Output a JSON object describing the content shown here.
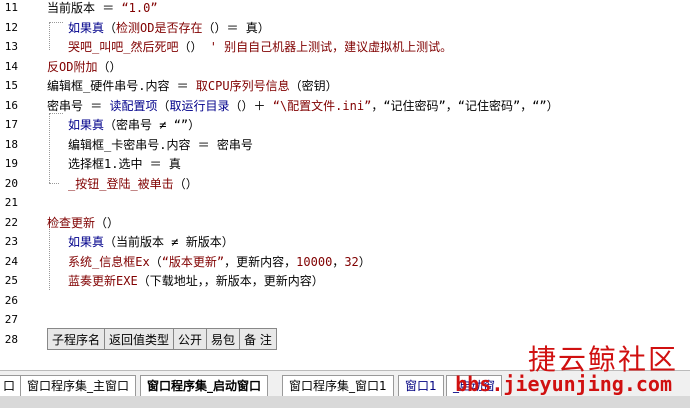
{
  "lines": [
    {
      "num": "11",
      "indent": 47,
      "parts": [
        {
          "c": "blk",
          "t": "当前版本 ＝ "
        },
        {
          "c": "fn",
          "t": "“1.0”"
        }
      ]
    },
    {
      "num": "12",
      "indent": 68,
      "parts": [
        {
          "c": "kw",
          "t": "如果真"
        },
        {
          "c": "blk",
          "t": "（"
        },
        {
          "c": "fn",
          "t": "检测OD是否存在"
        },
        {
          "c": "blk",
          "t": "（）＝ 真）"
        }
      ]
    },
    {
      "num": "13",
      "indent": 68,
      "parts": [
        {
          "c": "fn",
          "t": "哭吧_叫吧_然后死吧"
        },
        {
          "c": "blk",
          "t": "（） "
        },
        {
          "c": "fn",
          "t": "' 别自自己机器上测试，建议虚拟机上测试。"
        }
      ]
    },
    {
      "num": "14",
      "indent": 47,
      "parts": [
        {
          "c": "fn",
          "t": "反OD附加"
        },
        {
          "c": "blk",
          "t": "（）"
        }
      ]
    },
    {
      "num": "15",
      "indent": 47,
      "parts": [
        {
          "c": "blk",
          "t": "编辑框_硬件串号.内容 ＝ "
        },
        {
          "c": "fn",
          "t": "取CPU序列号信息"
        },
        {
          "c": "blk",
          "t": "（密钥）"
        }
      ]
    },
    {
      "num": "16",
      "indent": 47,
      "parts": [
        {
          "c": "blk",
          "t": "密串号 ＝ "
        },
        {
          "c": "kw",
          "t": "读配置项"
        },
        {
          "c": "blk",
          "t": "（"
        },
        {
          "c": "kw",
          "t": "取运行目录"
        },
        {
          "c": "blk",
          "t": "（）＋ "
        },
        {
          "c": "fn",
          "t": "“\\配置文件.ini”"
        },
        {
          "c": "blk",
          "t": "，“记住密码”，“记住密码”，“”）"
        }
      ]
    },
    {
      "num": "17",
      "indent": 68,
      "parts": [
        {
          "c": "kw",
          "t": "如果真"
        },
        {
          "c": "blk",
          "t": "（密串号 ≠ “”）"
        }
      ]
    },
    {
      "num": "18",
      "indent": 68,
      "parts": [
        {
          "c": "blk",
          "t": "编辑框_卡密串号.内容 ＝ 密串号"
        }
      ]
    },
    {
      "num": "19",
      "indent": 68,
      "parts": [
        {
          "c": "blk",
          "t": "选择框1.选中 ＝ 真"
        }
      ]
    },
    {
      "num": "20",
      "indent": 68,
      "parts": [
        {
          "c": "fn",
          "t": "_按钮_登陆_被单击"
        },
        {
          "c": "blk",
          "t": "（）"
        }
      ]
    },
    {
      "num": "21",
      "indent": 47,
      "parts": []
    },
    {
      "num": "22",
      "indent": 47,
      "parts": [
        {
          "c": "fn",
          "t": "检查更新"
        },
        {
          "c": "blk",
          "t": "（）"
        }
      ]
    },
    {
      "num": "23",
      "indent": 68,
      "parts": [
        {
          "c": "kw",
          "t": "如果真"
        },
        {
          "c": "blk",
          "t": "（当前版本 ≠ 新版本）"
        }
      ]
    },
    {
      "num": "24",
      "indent": 68,
      "parts": [
        {
          "c": "fn",
          "t": "系统_信息框Ex"
        },
        {
          "c": "blk",
          "t": "（"
        },
        {
          "c": "fn",
          "t": "“版本更新”"
        },
        {
          "c": "blk",
          "t": "，更新内容，"
        },
        {
          "c": "fn",
          "t": "10000"
        },
        {
          "c": "blk",
          "t": "，"
        },
        {
          "c": "fn",
          "t": "32"
        },
        {
          "c": "blk",
          "t": "）"
        }
      ]
    },
    {
      "num": "25",
      "indent": 68,
      "parts": [
        {
          "c": "fn",
          "t": "蓝奏更新EXE"
        },
        {
          "c": "blk",
          "t": "（下载地址，，新版本，更新内容）"
        }
      ]
    },
    {
      "num": "26",
      "indent": 47,
      "parts": []
    },
    {
      "num": "27",
      "indent": 47,
      "parts": []
    },
    {
      "num": "28",
      "indent": 47,
      "parts": []
    }
  ],
  "table": {
    "headers": [
      "子程序名",
      "返回值类型",
      "公开",
      "易包",
      "备 注"
    ]
  },
  "tabs": [
    {
      "label": "口",
      "active": false,
      "blue": false
    },
    {
      "label": "窗口程序集_主窗口",
      "active": false,
      "blue": false
    },
    {
      "label": "窗口程序集_启动窗口",
      "active": true,
      "blue": false
    },
    {
      "label": "窗口程序集_窗口1",
      "active": false,
      "blue": false
    },
    {
      "label": "窗口1",
      "active": false,
      "blue": true
    },
    {
      "label": "_启动窗",
      "active": false,
      "blue": true
    }
  ],
  "watermark": {
    "title": "捷云鲸社区",
    "url": "bbs.jieyunjing.com"
  }
}
